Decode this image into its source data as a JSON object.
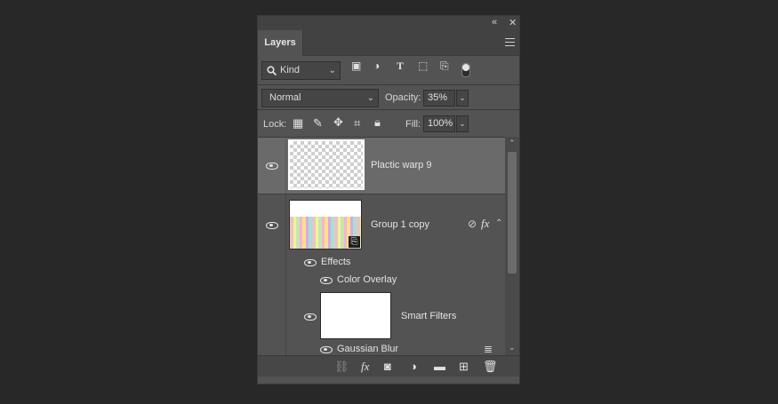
{
  "panel": {
    "title_tab": "Layers",
    "collapse_icon": "double-chevron-left-icon",
    "close_icon": "close-icon",
    "menu_icon": "panel-menu-icon"
  },
  "filter": {
    "kind_label": "Kind",
    "icons": [
      "pixel-layer-filter-icon",
      "adjustment-layer-filter-icon",
      "type-layer-filter-icon",
      "shape-layer-filter-icon",
      "smart-object-filter-icon"
    ],
    "toggle_state": "on"
  },
  "blend": {
    "mode": "Normal",
    "opacity_label": "Opacity:",
    "opacity_value": "35%"
  },
  "lock": {
    "label": "Lock:",
    "icons": [
      "lock-transparent-pixels-icon",
      "lock-image-pixels-icon",
      "lock-position-icon",
      "lock-artboard-icon",
      "lock-all-icon"
    ],
    "fill_label": "Fill:",
    "fill_value": "100%"
  },
  "layers": [
    {
      "name": "Plactic warp 9",
      "visible": true,
      "selected": true
    },
    {
      "name": "Group 1 copy",
      "visible": true,
      "selected": false
    }
  ],
  "effects": {
    "label": "Effects",
    "items": [
      "Color Overlay"
    ]
  },
  "smart_filters": {
    "label": "Smart Filters",
    "items": [
      "Gaussian Blur"
    ]
  },
  "bottom_icons": [
    "link-layers-icon",
    "add-layer-style-icon",
    "add-mask-icon",
    "new-fill-adjustment-icon",
    "new-group-icon",
    "new-layer-icon",
    "delete-layer-icon"
  ],
  "colors": {
    "background": "#282828",
    "panel": "#535353",
    "selected_row": "#6a6a6a"
  }
}
